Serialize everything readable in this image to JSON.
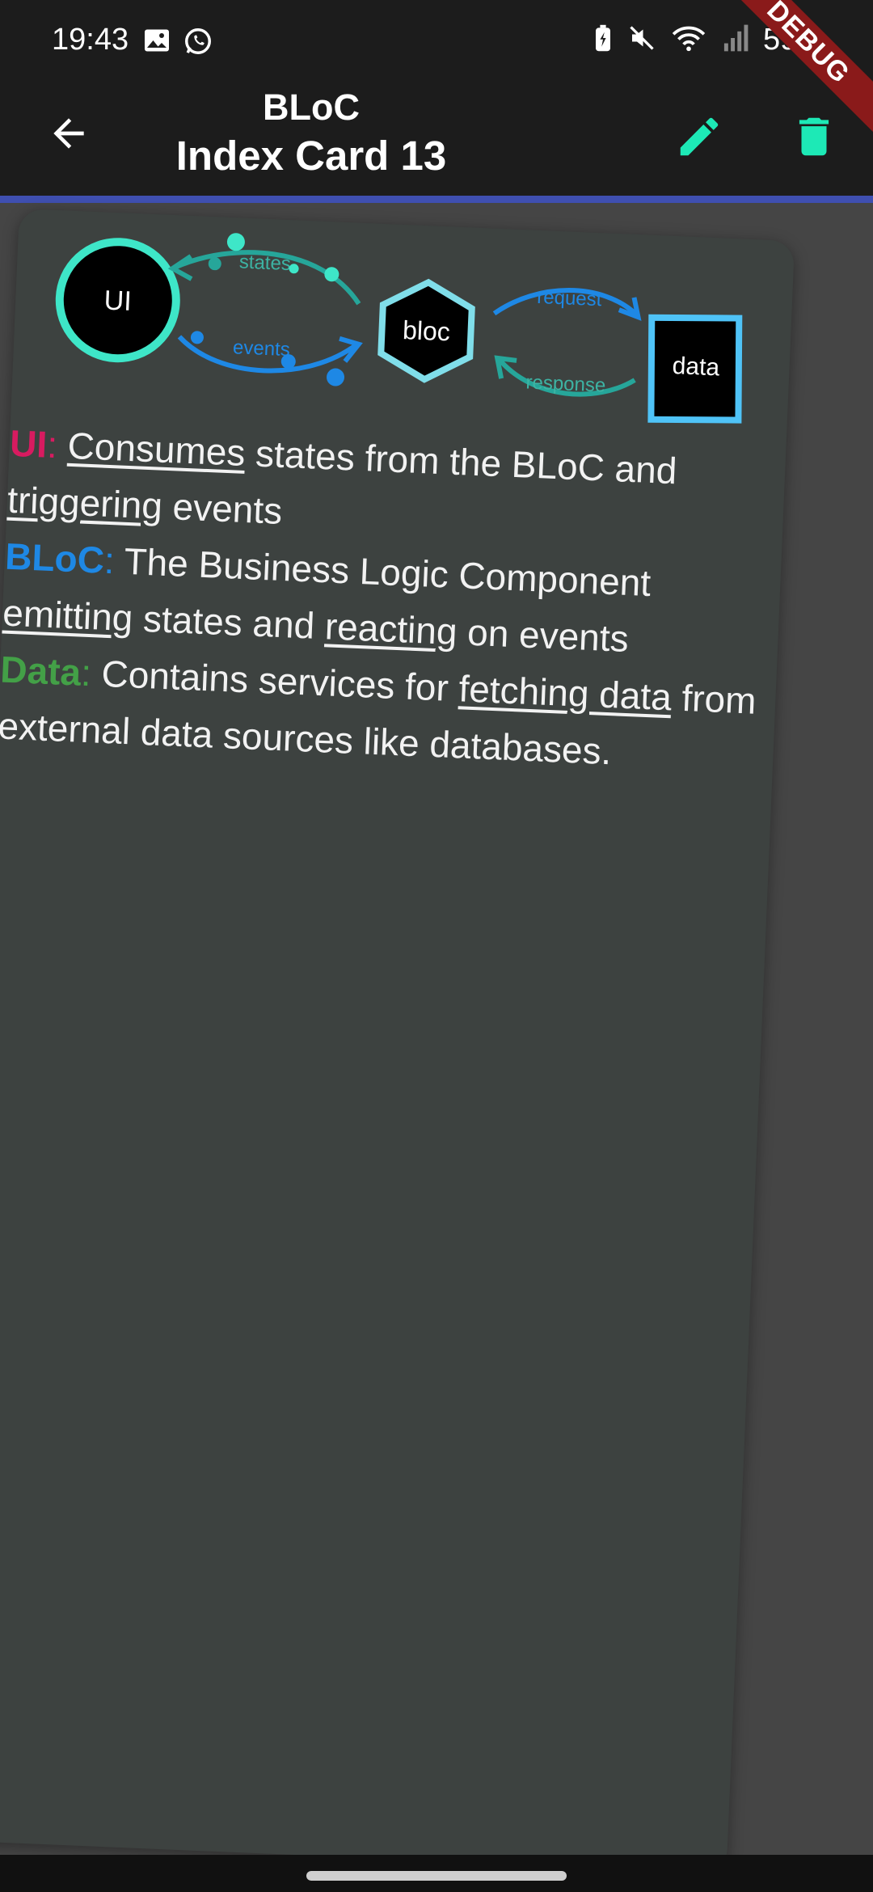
{
  "status_bar": {
    "time": "19:43",
    "battery": "59%",
    "left_icons": [
      "image-icon",
      "whatsapp-icon"
    ],
    "right_icons": [
      "battery-saver-icon",
      "mute-icon",
      "wifi-icon",
      "signal-icon"
    ]
  },
  "app_bar": {
    "title_top": "BLoC",
    "title_bottom": "Index Card 13",
    "back_icon": "arrow-back-icon",
    "edit_icon": "pencil-icon",
    "delete_icon": "trash-icon",
    "accent_color": "#1de9b6"
  },
  "debug_banner": "DEBUG",
  "diagram": {
    "ui_label": "UI",
    "bloc_label": "bloc",
    "data_label": "data",
    "states_label": "states",
    "events_label": "events",
    "request_label": "request",
    "response_label": "response"
  },
  "card": {
    "ui_term": "UI",
    "ui_colon": ":",
    "ui_word1": "Consumes",
    "ui_text1": " states from the BLoC and ",
    "ui_word2": "triggering",
    "ui_text2": " events",
    "bloc_term": "BLoC",
    "bloc_colon": ":",
    "bloc_text1": " The Business Logic Component ",
    "bloc_word1": "emitting",
    "bloc_text2": " states and ",
    "bloc_word2": "reacting",
    "bloc_text3": " on events",
    "data_term": "Data",
    "data_colon": ":",
    "data_text1": " Contains services for ",
    "data_word1": "fetching data",
    "data_text2": " from external data sources like databases."
  },
  "colors": {
    "ui": "#d81b60",
    "bloc": "#1e88e5",
    "data": "#43a047",
    "card_bg": "#3d4240"
  }
}
